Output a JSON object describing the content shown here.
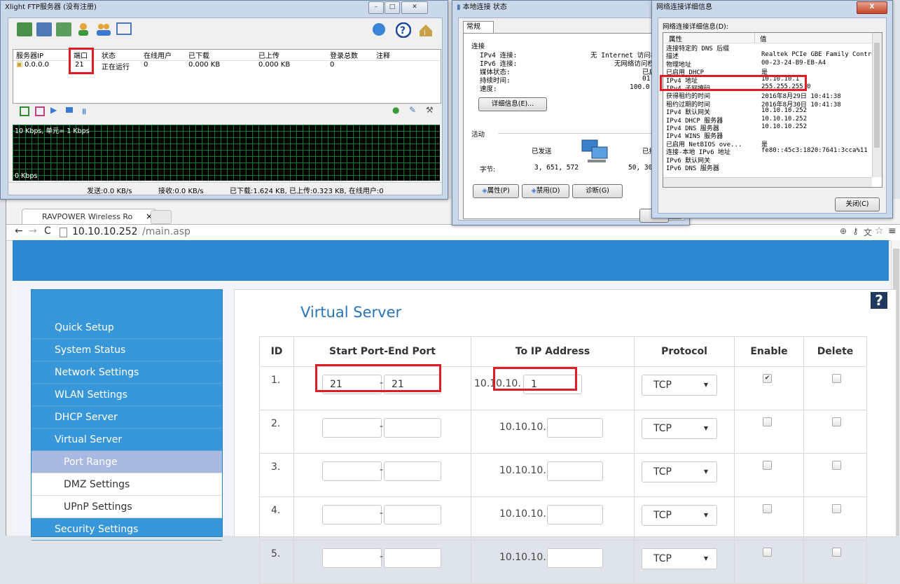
{
  "ftp": {
    "title": "Xlight FTP服务器 (没有注册)",
    "headers": [
      "服务器IP",
      "端口",
      "状态",
      "在线用户",
      "已下载",
      "已上传",
      "登录总数",
      "注释"
    ],
    "row": [
      "0.0.0.0",
      "21",
      "正在运行",
      "0",
      "0.000 KB",
      "0.000 KB",
      "0"
    ],
    "graph_top": "10 Kbps, 单元= 1 Kbps",
    "graph_bottom": "0 Kbps",
    "status": [
      "发送:0.0 KB/s",
      "接收:0.0 KB/s",
      "已下载:1.624 KB, 已上传:0.323 KB, 在线用户:0"
    ]
  },
  "conn": {
    "title": "本地连接 状态",
    "tab": "常规",
    "group_connection": "连接",
    "rows": [
      {
        "k": "IPv4 连接:",
        "v": "无 Internet 访问权"
      },
      {
        "k": "IPv6 连接:",
        "v": "无网络访问权"
      },
      {
        "k": "媒体状态:",
        "v": "已启"
      },
      {
        "k": "持续时间:",
        "v": "01:49"
      },
      {
        "k": "速度:",
        "v": "100.0 M"
      }
    ],
    "details_button": "详细信息(E)...",
    "group_activity": "活动",
    "sent_label": "已发送",
    "recv_label": "已接",
    "bytes_label": "字节:",
    "bytes_sent": "3, 651, 572",
    "bytes_recv": "50, 301,",
    "buttons": [
      "属性(P)",
      "禁用(D)",
      "诊断(G)"
    ],
    "close_partial": "关"
  },
  "detail": {
    "title": "网络连接详细信息",
    "label": "网络连接详细信息(D):",
    "col_prop": "属性",
    "col_value": "值",
    "rows": [
      {
        "k": "连接特定的 DNS 后缀",
        "v": ""
      },
      {
        "k": "描述",
        "v": "Realtek PCIe GBE Family Contro"
      },
      {
        "k": "物理地址",
        "v": "00-23-24-B9-EB-A4"
      },
      {
        "k": "已启用 DHCP",
        "v": "是"
      },
      {
        "k": "IPv4 地址",
        "v": "10.10.10.1"
      },
      {
        "k": "IPv4 子网掩码",
        "v": "255.255.255.0"
      },
      {
        "k": "获得租约的时间",
        "v": "2016年8月29日 10:41:38"
      },
      {
        "k": "租约过期的时间",
        "v": "2016年8月30日 10:41:38"
      },
      {
        "k": "IPv4 默认网关",
        "v": "10.10.10.252"
      },
      {
        "k": "IPv4 DHCP 服务器",
        "v": "10.10.10.252"
      },
      {
        "k": "IPv4 DNS 服务器",
        "v": "10.10.10.252"
      },
      {
        "k": "IPv4 WINS 服务器",
        "v": ""
      },
      {
        "k": "已启用 NetBIOS ove...",
        "v": "是"
      },
      {
        "k": "连接-本地 IPv6 地址",
        "v": "fe80::45c3:1820:7641:3cca%11"
      },
      {
        "k": "IPv6 默认网关",
        "v": ""
      },
      {
        "k": "IPv6 DNS 服务器",
        "v": ""
      }
    ],
    "close_button": "关闭(C)",
    "close_x": "X"
  },
  "browser": {
    "tab_title": "RAVPOWER Wireless Ro",
    "tab_close": "×",
    "url_host": "10.10.10.252",
    "url_path": "/main.asp",
    "help": "?"
  },
  "sidebar": {
    "items": [
      "Quick Setup",
      "System Status",
      "Network Settings",
      "WLAN Settings",
      "DHCP Server",
      "Virtual Server"
    ],
    "sub_items": [
      "Port Range",
      "DMZ Settings",
      "UPnP Settings"
    ],
    "last_item": "Security Settings"
  },
  "vs": {
    "title": "Virtual Server",
    "headers": [
      "ID",
      "Start Port-End Port",
      "To IP Address",
      "Protocol",
      "Enable",
      "Delete"
    ],
    "ip_prefix": "10.10.10.",
    "dash": "-",
    "rows": [
      {
        "id": "1.",
        "start": "21",
        "end": "21",
        "ip": "1",
        "protocol": "TCP",
        "enable": "✔",
        "delete": ""
      },
      {
        "id": "2.",
        "start": "",
        "end": "",
        "ip": "",
        "protocol": "TCP",
        "enable": "",
        "delete": ""
      },
      {
        "id": "3.",
        "start": "",
        "end": "",
        "ip": "",
        "protocol": "TCP",
        "enable": "",
        "delete": ""
      },
      {
        "id": "4.",
        "start": "",
        "end": "",
        "ip": "",
        "protocol": "TCP",
        "enable": "",
        "delete": ""
      },
      {
        "id": "5.",
        "start": "",
        "end": "",
        "ip": "",
        "protocol": "TCP",
        "enable": "",
        "delete": ""
      }
    ]
  },
  "colors": {
    "router_blue": "#2b88d0",
    "sidebar_blue": "#3897d8",
    "title_blue": "#2a74b8",
    "highlight": "#e01c24"
  }
}
